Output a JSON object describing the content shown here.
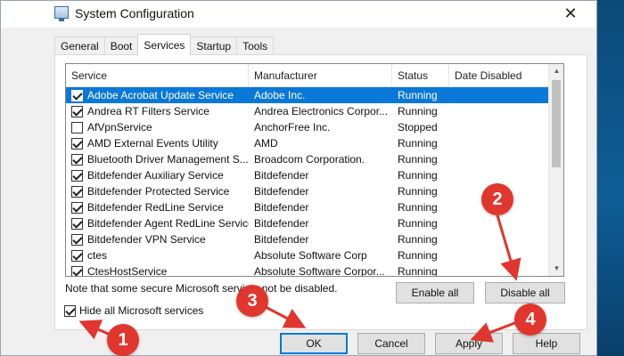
{
  "window": {
    "title": "System Configuration",
    "close_glyph": "✕",
    "app_icon": "system-config-icon"
  },
  "tabs": [
    {
      "label": "General",
      "active": false
    },
    {
      "label": "Boot",
      "active": false
    },
    {
      "label": "Services",
      "active": true
    },
    {
      "label": "Startup",
      "active": false
    },
    {
      "label": "Tools",
      "active": false
    }
  ],
  "services": {
    "columns": [
      "Service",
      "Manufacturer",
      "Status",
      "Date Disabled"
    ],
    "rows": [
      {
        "checked": true,
        "name": "Adobe Acrobat Update Service",
        "manufacturer": "Adobe Inc.",
        "status": "Running",
        "date_disabled": "",
        "selected": true
      },
      {
        "checked": true,
        "name": "Andrea RT Filters Service",
        "manufacturer": "Andrea Electronics Corpor...",
        "status": "Running",
        "date_disabled": ""
      },
      {
        "checked": false,
        "name": "AfVpnService",
        "manufacturer": "AnchorFree Inc.",
        "status": "Stopped",
        "date_disabled": ""
      },
      {
        "checked": true,
        "name": "AMD External Events Utility",
        "manufacturer": "AMD",
        "status": "Running",
        "date_disabled": ""
      },
      {
        "checked": true,
        "name": "Bluetooth Driver Management S...",
        "manufacturer": "Broadcom Corporation.",
        "status": "Running",
        "date_disabled": ""
      },
      {
        "checked": true,
        "name": "Bitdefender Auxiliary Service",
        "manufacturer": "Bitdefender",
        "status": "Running",
        "date_disabled": ""
      },
      {
        "checked": true,
        "name": "Bitdefender Protected Service",
        "manufacturer": "Bitdefender",
        "status": "Running",
        "date_disabled": ""
      },
      {
        "checked": true,
        "name": "Bitdefender RedLine Service",
        "manufacturer": "Bitdefender",
        "status": "Running",
        "date_disabled": ""
      },
      {
        "checked": true,
        "name": "Bitdefender Agent RedLine Service",
        "manufacturer": "Bitdefender",
        "status": "Running",
        "date_disabled": ""
      },
      {
        "checked": true,
        "name": "Bitdefender VPN Service",
        "manufacturer": "Bitdefender",
        "status": "Running",
        "date_disabled": ""
      },
      {
        "checked": true,
        "name": "ctes",
        "manufacturer": "Absolute Software Corp",
        "status": "Running",
        "date_disabled": ""
      },
      {
        "checked": true,
        "name": "CtesHostService",
        "manufacturer": "Absolute Software Corpor...",
        "status": "Running",
        "date_disabled": ""
      }
    ]
  },
  "note": "Note that some secure Microsoft servi      ay not be disabled.",
  "buttons": {
    "enable_all": "Enable all",
    "disable_all": "Disable all",
    "ok": "OK",
    "cancel": "Cancel",
    "apply": "Apply",
    "help": "Help"
  },
  "hide_ms": {
    "label": "Hide all Microsoft services",
    "checked": true
  },
  "annotations": [
    "1",
    "2",
    "3",
    "4"
  ],
  "colors": {
    "selection": "#0a78d7",
    "annotation": "#e0362d",
    "default_button_border": "#0078d7"
  }
}
